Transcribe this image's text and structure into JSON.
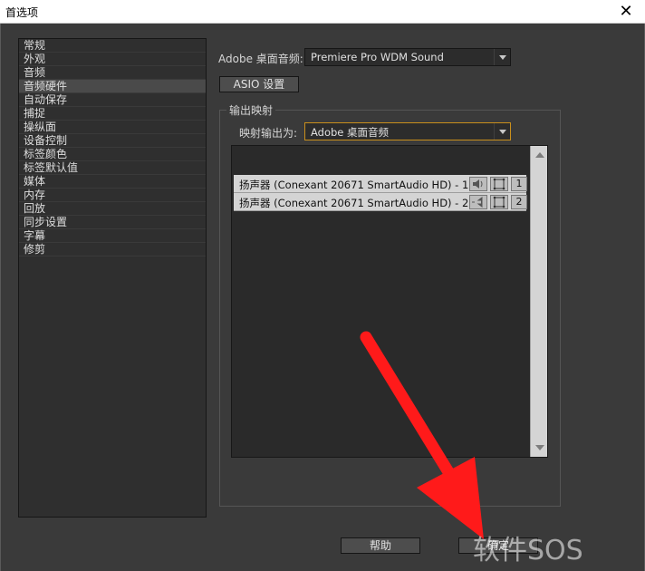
{
  "window": {
    "title": "首选项",
    "close_glyph": "✕"
  },
  "sidebar": {
    "items": [
      {
        "label": "常规"
      },
      {
        "label": "外观"
      },
      {
        "label": "音频"
      },
      {
        "label": "音频硬件"
      },
      {
        "label": "自动保存"
      },
      {
        "label": "捕捉"
      },
      {
        "label": "操纵面"
      },
      {
        "label": "设备控制"
      },
      {
        "label": "标签颜色"
      },
      {
        "label": "标签默认值"
      },
      {
        "label": "媒体"
      },
      {
        "label": "内存"
      },
      {
        "label": "回放"
      },
      {
        "label": "同步设置"
      },
      {
        "label": "字幕"
      },
      {
        "label": "修剪"
      }
    ],
    "selected_label": "音频硬件"
  },
  "audio": {
    "device_label": "Adobe 桌面音频:",
    "device_value": "Premiere Pro WDM Sound",
    "asio_button": "ASIO 设置"
  },
  "output_mapping": {
    "group_title": "输出映射",
    "map_label": "映射输出为:",
    "map_value": "Adobe 桌面音频",
    "channels": [
      {
        "label": "扬声器 (Conexant 20671 SmartAudio HD) - 1",
        "number": "1"
      },
      {
        "label": "扬声器 (Conexant 20671 SmartAudio HD) - 2",
        "number": "2"
      }
    ]
  },
  "footer": {
    "help_button": "帮助",
    "ok_button": "确定"
  },
  "watermark": "软件SOS",
  "colors": {
    "annotation_arrow": "#ff1a1a",
    "focus_border": "#c98f1c"
  }
}
